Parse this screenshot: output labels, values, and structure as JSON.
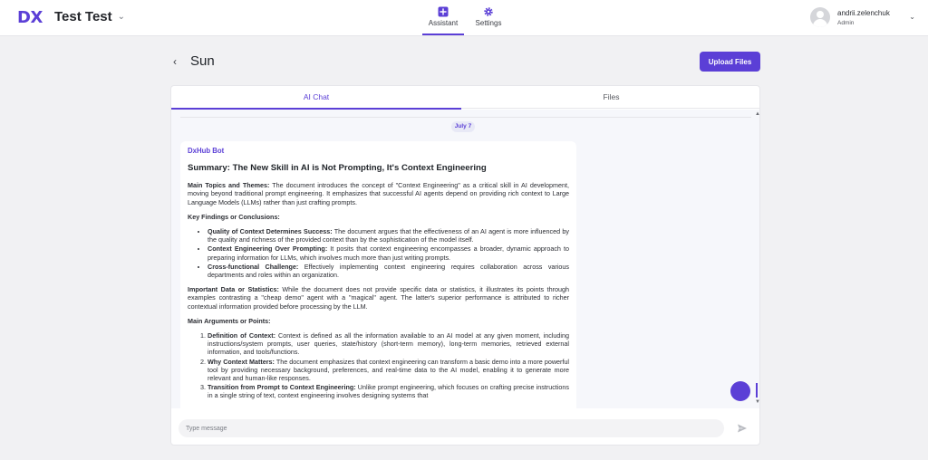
{
  "header": {
    "logo": "DX",
    "project_name": "Test Test",
    "nav": [
      {
        "label": "Assistant",
        "icon": "plus-square-icon",
        "active": true
      },
      {
        "label": "Settings",
        "icon": "gear-icon",
        "active": false
      }
    ],
    "user": {
      "name": "andrii.zelenchuk",
      "role": "Admin"
    }
  },
  "page": {
    "title": "Sun",
    "upload_button": "Upload Files"
  },
  "tabs": [
    {
      "label": "AI Chat",
      "active": true
    },
    {
      "label": "Files",
      "active": false
    }
  ],
  "chat": {
    "date": "July 7",
    "message": {
      "sender": "DxHub Bot",
      "title": "Summary: The New Skill in AI is Not Prompting, It's Context Engineering",
      "main_topics_heading": "Main Topics and Themes:",
      "main_topics_text": " The document introduces the concept of \"Context Engineering\" as a critical skill in AI development, moving beyond traditional prompt engineering. It emphasizes that successful AI agents depend on providing rich context to Large Language Models (LLMs) rather than just crafting prompts.",
      "findings_heading": "Key Findings or Conclusions:",
      "findings": [
        {
          "bold": "Quality of Context Determines Success:",
          "text": " The document argues that the effectiveness of an AI agent is more influenced by the quality and richness of the provided context than by the sophistication of the model itself."
        },
        {
          "bold": "Context Engineering Over Prompting:",
          "text": " It posits that context engineering encompasses a broader, dynamic approach to preparing information for LLMs, which involves much more than just writing prompts."
        },
        {
          "bold": "Cross-functional Challenge:",
          "text": " Effectively implementing context engineering requires collaboration across various departments and roles within an organization."
        }
      ],
      "data_heading": "Important Data or Statistics:",
      "data_text": " While the document does not provide specific data or statistics, it illustrates its points through examples contrasting a \"cheap demo\" agent with a \"magical\" agent. The latter's superior performance is attributed to richer contextual information provided before processing by the LLM.",
      "arguments_heading": "Main Arguments or Points:",
      "arguments": [
        {
          "bold": "Definition of Context:",
          "text": " Context is defined as all the information available to an AI model at any given moment, including instructions/system prompts, user queries, state/history (short-term memory), long-term memories, retrieved external information, and tools/functions."
        },
        {
          "bold": "Why Context Matters:",
          "text": " The document emphasizes that context engineering can transform a basic demo into a more powerful tool by providing necessary background, preferences, and real-time data to the AI model, enabling it to generate more relevant and human-like responses."
        },
        {
          "bold": "Transition from Prompt to Context Engineering:",
          "text": " Unlike prompt engineering, which focuses on crafting precise instructions in a single string of text, context engineering involves designing systems that"
        }
      ]
    },
    "input_placeholder": "Type message"
  },
  "colors": {
    "accent": "#5b3fd6",
    "background": "#f1f1f3",
    "chat_bg": "#f6f7fb"
  }
}
